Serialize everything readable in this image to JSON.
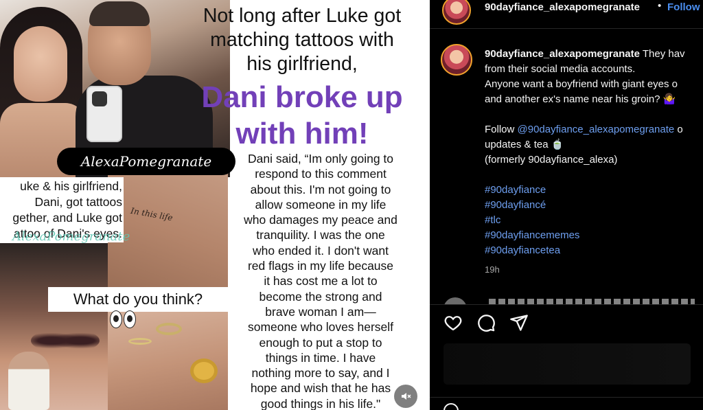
{
  "post_image": {
    "watermark": "AlexaPomegranate",
    "script_watermark": "AlexaPomegranate",
    "tattoo_text": "In this life",
    "caption_left": [
      "uke & his girlfriend,",
      "Dani, got tattoos",
      "gether, and Luke got",
      "attoo of Dani's eyes."
    ],
    "question": "What do you think?",
    "headline": [
      "Not long after Luke got",
      "matching tattoos with",
      "his girlfriend,"
    ],
    "headline_purple": [
      "Dani broke up",
      "with him!"
    ],
    "quote": [
      "Dani said, “Im only going to",
      "respond to this comment",
      "about this. I'm not going to",
      "allow someone in my life",
      "who damages my peace and",
      "tranquility. I was the one",
      "who ended it. I don't want",
      "red flags in my life because",
      "it has cost me a lot to",
      "become the strong and",
      "brave woman I am—",
      "someone who loves herself",
      "enough to put a stop to",
      "things in time. I have",
      "nothing more to say, and I",
      "hope and wish that he has",
      "good things in his life.\""
    ],
    "mute_icon": "speaker-muted-icon"
  },
  "header": {
    "username": "90dayfiance_alexapomegranate",
    "dot": "•",
    "follow_label": "Follow"
  },
  "caption": {
    "username": "90dayfiance_alexapomegranate",
    "line1_rest": " They hav",
    "line2": "from their social media accounts.",
    "line3": "Anyone want a boyfriend with giant eyes o",
    "line4": "and another ex's name near his groin? 🤷‍♀️",
    "follow_prefix": "Follow ",
    "follow_mention": "@90dayfiance_alexapomegranate",
    "follow_suffix": " o",
    "line6": "updates & tea 🍵",
    "line7": "(formerly 90dayfiance_alexa)",
    "hashtags": [
      "#90dayfiance",
      "#90dayfiancé",
      "#tlc",
      "#90dayfiancememes",
      "#90dayfiancetea"
    ],
    "timestamp": "19h"
  },
  "actions": {
    "like_icon": "heart-icon",
    "comment_icon": "comment-icon",
    "share_icon": "send-icon"
  },
  "colors": {
    "accent": "#4a8ef0",
    "headline_purple": "#7240b8",
    "background": "#000000"
  }
}
